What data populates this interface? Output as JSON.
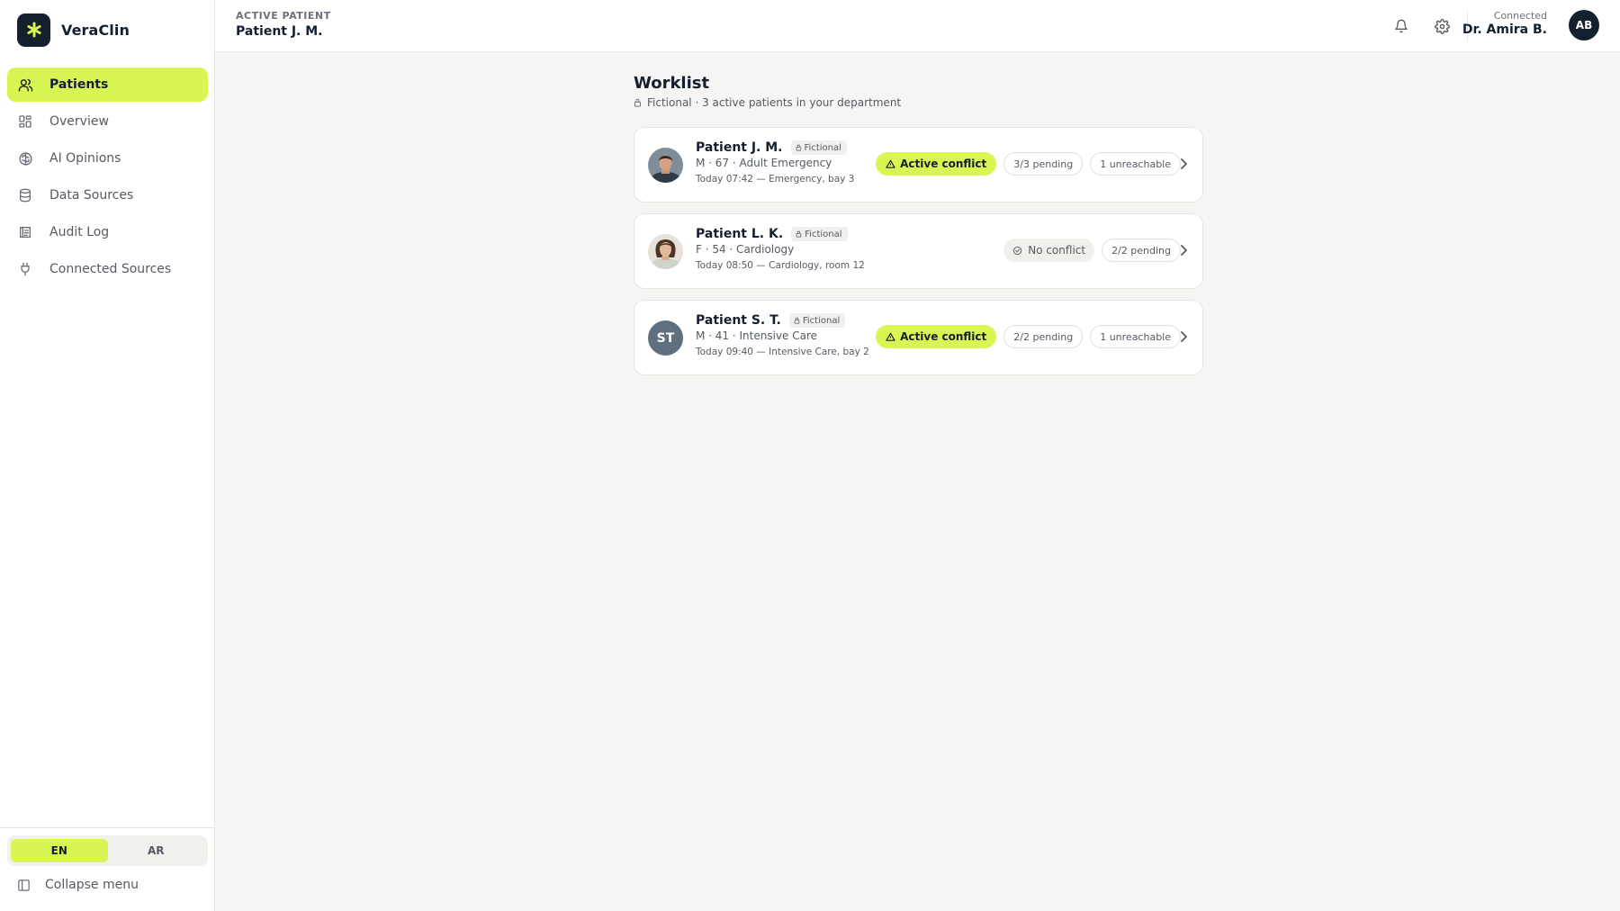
{
  "app": {
    "name": "VeraClin",
    "logo_icon": "asterisk-icon",
    "accent": "#d9f553",
    "brand_dark": "#15202e"
  },
  "sidebar": {
    "items": [
      {
        "label": "Patients",
        "icon": "users-icon",
        "active": true
      },
      {
        "label": "Overview",
        "icon": "grid-icon"
      },
      {
        "label": "AI Opinions",
        "icon": "brain-icon"
      },
      {
        "label": "Data Sources",
        "icon": "database-icon"
      },
      {
        "label": "Audit Log",
        "icon": "audit-icon"
      },
      {
        "label": "Connected Sources",
        "icon": "plug-icon"
      }
    ],
    "languages": [
      "EN",
      "AR"
    ],
    "active_language": "EN",
    "collapse_label": "Collapse menu"
  },
  "header": {
    "active_label": "ACTIVE PATIENT",
    "active_patient": "Patient J. M.",
    "status": "Connected",
    "user_name": "Dr. Amira B.",
    "user_initials": "AB"
  },
  "worklist": {
    "title": "Worklist",
    "subtitle": "Fictional · 3 active patients in your department",
    "patients": [
      {
        "name": "Patient J. M.",
        "tag": "Fictional",
        "meta": "M · 67 · Adult Emergency",
        "time": "Today 07:42 — Emergency, bay 3",
        "status": "Active conflict",
        "pending": "3/3 pending",
        "unreachable": "1 unreachable"
      },
      {
        "name": "Patient L. K.",
        "tag": "Fictional",
        "meta": "F · 54 · Cardiology",
        "time": "Today 08:50 — Cardiology, room 12",
        "status": "No conflict",
        "pending": "2/2 pending"
      },
      {
        "name": "Patient S. T.",
        "tag": "Fictional",
        "initials": "ST",
        "meta": "M · 41 · Intensive Care",
        "time": "Today 09:40 — Intensive Care, bay 2",
        "status": "Active conflict",
        "pending": "2/2 pending",
        "unreachable": "1 unreachable"
      }
    ]
  }
}
